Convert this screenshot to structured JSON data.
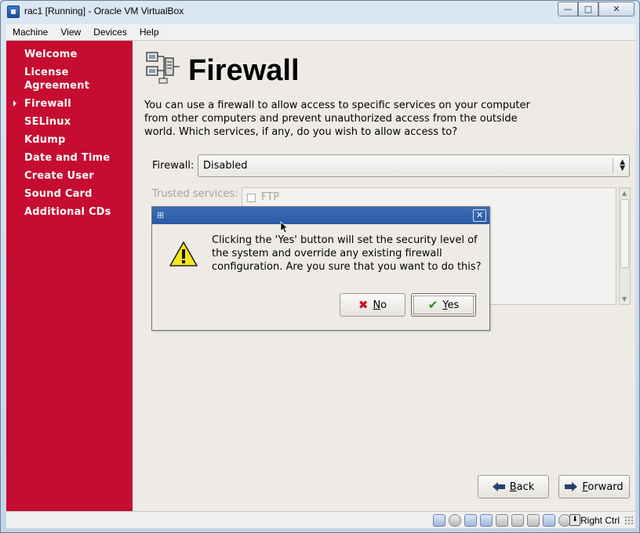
{
  "window": {
    "title": "rac1 [Running] - Oracle VM VirtualBox",
    "controls": {
      "minimize": "—",
      "maximize": "□",
      "close": "✕"
    }
  },
  "menubar": [
    "Machine",
    "View",
    "Devices",
    "Help"
  ],
  "sidebar": {
    "items": [
      {
        "label": "Welcome"
      },
      {
        "label": "License Agreement"
      },
      {
        "label": "Firewall",
        "current": true
      },
      {
        "label": "SELinux"
      },
      {
        "label": "Kdump"
      },
      {
        "label": "Date and Time"
      },
      {
        "label": "Create User"
      },
      {
        "label": "Sound Card"
      },
      {
        "label": "Additional CDs"
      }
    ]
  },
  "page": {
    "title": "Firewall",
    "intro": "You can use a firewall to allow access to specific services on your computer from other computers and prevent unauthorized access from the outside world.  Which services, if any, do you wish to allow access to?",
    "firewall_label": "Firewall:",
    "firewall_value": "Disabled",
    "trusted_label": "Trusted services:",
    "services": [
      {
        "name": "FTP",
        "checked": false
      }
    ],
    "back_label": "Back",
    "forward_label": "Forward"
  },
  "dialog": {
    "message": "Clicking the 'Yes' button will set the security level of the system and override any existing firewall configuration.  Are you sure that you want to do this?",
    "no_label": "No",
    "yes_label": "Yes"
  },
  "statusbar": {
    "host_key": "Right Ctrl",
    "icons": [
      "hard-disk-icon",
      "optical-drive-icon",
      "usb-icon",
      "network-icon",
      "shared-folders-icon",
      "display-icon",
      "video-capture-icon",
      "guest-additions-icon",
      "mouse-integration-icon",
      "host-key-icon"
    ]
  },
  "colors": {
    "sidebar": "#c60c30",
    "dialog_title": "#2a5aa4",
    "background": "#eeebe7"
  }
}
